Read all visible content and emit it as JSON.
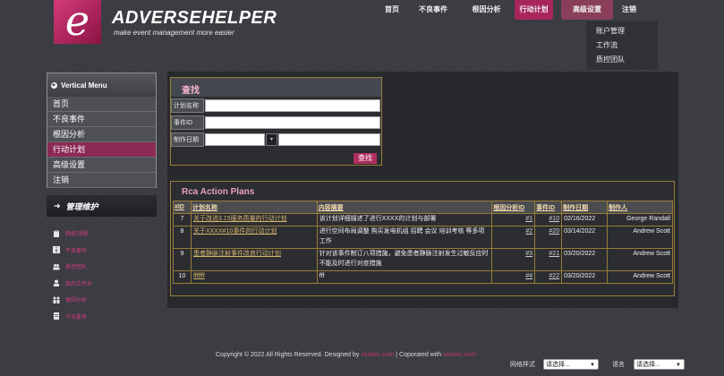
{
  "brand": {
    "logo_letter": "e",
    "name": "ADVERSEHELPER",
    "tagline": "make event management more easier"
  },
  "topnav": [
    {
      "label": "首页"
    },
    {
      "label": "不良事件"
    },
    {
      "label": "根因分析"
    },
    {
      "label": "行动计划"
    },
    {
      "label": "高级设置"
    },
    {
      "label": "注销"
    }
  ],
  "dropdown": {
    "items": [
      {
        "label": "账户管理"
      },
      {
        "label": "工作流"
      },
      {
        "label": "质控团队"
      }
    ]
  },
  "vertical_menu": {
    "title": "Vertical Menu",
    "items": [
      {
        "label": "首页"
      },
      {
        "label": "不良事件"
      },
      {
        "label": "根因分析"
      },
      {
        "label": "行动计划"
      },
      {
        "label": "高级设置"
      },
      {
        "label": "注销"
      }
    ]
  },
  "management": {
    "title": "管理维护",
    "items": [
      {
        "label": "制度/流程",
        "icon": "clipboard-icon"
      },
      {
        "label": "不良事件",
        "icon": "info-icon"
      },
      {
        "label": "质控团队",
        "icon": "team-icon"
      },
      {
        "label": "我的工作台",
        "icon": "desk-icon"
      },
      {
        "label": "根因分析",
        "icon": "people-icon"
      },
      {
        "label": "今日要务",
        "icon": "document-icon"
      }
    ]
  },
  "search": {
    "title": "查找",
    "plan_name_label": "计划名称",
    "event_id_label": "事件ID",
    "date_label": "制作日期",
    "button_label": "查找"
  },
  "plans": {
    "title": "Rca Action Plans",
    "columns": [
      "#ID",
      "计划名称",
      "内容摘要",
      "根因分析ID",
      "事件ID",
      "制作日期",
      "制作人"
    ],
    "rows": [
      {
        "id": "7",
        "name": "关于改进3.15服务质量的行动计划",
        "summary": "该计划详细描述了进行XXXX的计划与部署",
        "rca_id": "#1",
        "event_id": "#10",
        "date": "02/16/2022",
        "author": "George Randall"
      },
      {
        "id": "8",
        "name": "关于XXXX#10事件的行动计划",
        "summary": "进行空间布局调整 购买发电机组 招聘 会议 培训考核 等多项工作",
        "rca_id": "#2",
        "event_id": "#20",
        "date": "03/14/2022",
        "author": "Andrew Scott"
      },
      {
        "id": "9",
        "name": "患者静脉注射事件改良行动计划",
        "summary": "针对该事件制订八项措施，避免患者静脉注射发生过敏反应时不能及时进行对症措施",
        "rca_id": "#3",
        "event_id": "#21",
        "date": "03/20/2022",
        "author": "Andrew Scott"
      },
      {
        "id": "10",
        "name": "fffffff",
        "summary": "fff",
        "rca_id": "#4",
        "event_id": "#22",
        "date": "03/20/2022",
        "author": "Andrew Scott"
      }
    ]
  },
  "footer": {
    "copyright": "Copyright © 2022 All Rights Reserved. Designed by",
    "designer": "xxxdec.com",
    "separator": " | Coporated with ",
    "partner": "xxxuec.com",
    "style_label": "网格样式",
    "style_value": "请选择...",
    "lang_label": "语言",
    "lang_value": "请选择..."
  },
  "colors": {
    "accent": "#a8265c",
    "link": "#d7b66c",
    "border": "#9a7c38"
  }
}
